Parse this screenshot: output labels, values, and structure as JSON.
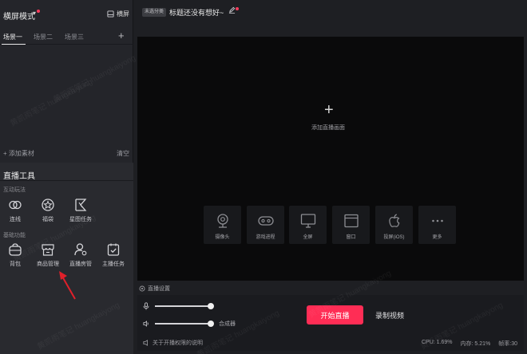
{
  "left_panel": {
    "mode_title": "横屏模式",
    "mode_caret": "▾",
    "landscape_label": "横屏",
    "scene_tabs": [
      {
        "label": "场景一",
        "active": true
      },
      {
        "label": "场景二",
        "active": false
      },
      {
        "label": "场景三",
        "active": false
      }
    ],
    "add_scene": "+",
    "add_material": "+ 添加素材",
    "clear": "清空"
  },
  "tools": {
    "title": "直播工具",
    "interactive_group": "互动玩法",
    "interactive": [
      {
        "label": "连线",
        "icon": "link-icon"
      },
      {
        "label": "福袋",
        "icon": "lucky-bag-icon"
      },
      {
        "label": "星图任务",
        "icon": "star-map-icon"
      }
    ],
    "basic_group": "基础功能",
    "basic": [
      {
        "label": "背包",
        "icon": "backpack-icon"
      },
      {
        "label": "商品管理",
        "icon": "shop-icon"
      },
      {
        "label": "直播房管",
        "icon": "user-gear-icon"
      },
      {
        "label": "主播任务",
        "icon": "task-icon"
      }
    ]
  },
  "topbar": {
    "category_badge": "未选分类",
    "stream_title": "标题还没有想好~"
  },
  "preview": {
    "add_icon": "+",
    "add_label": "添加直播画面",
    "sources": [
      {
        "label": "摄像头",
        "icon": "camera-icon"
      },
      {
        "label": "游戏进程",
        "icon": "gamepad-icon"
      },
      {
        "label": "全屏",
        "icon": "monitor-icon"
      },
      {
        "label": "窗口",
        "icon": "window-icon"
      },
      {
        "label": "投屏(iOS)",
        "icon": "apple-icon"
      },
      {
        "label": "更多",
        "icon": "more-icon"
      }
    ]
  },
  "controls": {
    "live_settings": "直播设置",
    "mic_level": 1.0,
    "speaker_level": 1.0,
    "mixer_label": "合成器",
    "start_live": "开始直播",
    "record_video": "录制视频",
    "privilege_note": "关于开播权限的说明",
    "cpu": "CPU: 1.69%",
    "memory": "内存: 5.21%",
    "fps": "帧率:30"
  },
  "watermark": "黄凯雨笔记 huangkaiyong",
  "colors": {
    "accent": "#ff2d55",
    "notify_dot": "#ff3b5c",
    "panel": "#24252a",
    "preview": "#0a0a0b"
  }
}
